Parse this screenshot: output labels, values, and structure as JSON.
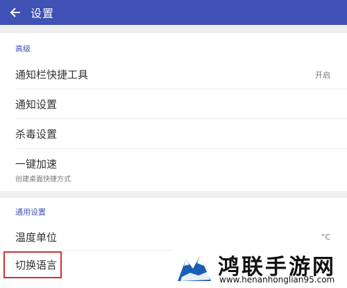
{
  "header": {
    "title": "设置",
    "back_icon": "arrow-left-icon"
  },
  "advanced": {
    "section_title": "高级",
    "items": [
      {
        "label": "通知栏快捷工具",
        "value": "开启"
      },
      {
        "label": "通知设置"
      },
      {
        "label": "杀毒设置"
      },
      {
        "label": "一键加速",
        "subtitle": "创建桌面快捷方式"
      }
    ]
  },
  "general": {
    "section_title": "通用设置",
    "items": [
      {
        "label": "温度单位",
        "value": "°C"
      },
      {
        "label": "切换语言"
      }
    ]
  },
  "watermark": {
    "text": "鸿联手游网",
    "url": "www.henanhonglian95.com"
  },
  "colors": {
    "appbar": "#3f51b5",
    "accent": "#3f51b5",
    "highlight_border": "#d32f2f"
  }
}
